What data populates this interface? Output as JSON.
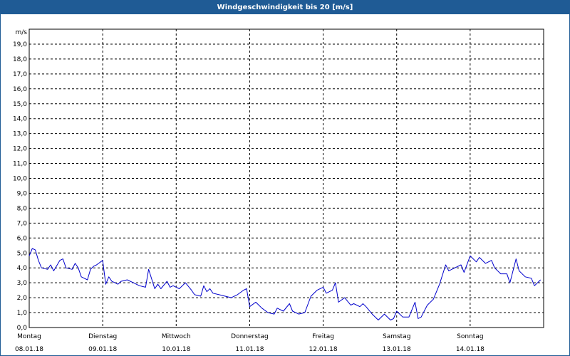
{
  "colors": {
    "title_bg": "#1f5b95",
    "title_text": "#ffffff",
    "line": "#0000cc",
    "grid": "#000000"
  },
  "chart_data": {
    "type": "line",
    "title": "Windgeschwindigkeit bis 20 [m/s]",
    "ylabel": "m/s",
    "xlabel": "",
    "ylim": [
      0,
      20
    ],
    "xlim": [
      "2018-01-08 00:00",
      "2018-01-15 00:00"
    ],
    "y_ticks": [
      "0,0",
      "1,0",
      "2,0",
      "3,0",
      "4,0",
      "5,0",
      "6,0",
      "7,0",
      "8,0",
      "9,0",
      "10,0",
      "11,0",
      "12,0",
      "13,0",
      "14,0",
      "15,0",
      "16,0",
      "17,0",
      "18,0",
      "19,0"
    ],
    "x_ticks": [
      {
        "day": "Montag",
        "date": "08.01.18"
      },
      {
        "day": "Dienstag",
        "date": "09.01.18"
      },
      {
        "day": "Mittwoch",
        "date": "10.01.18"
      },
      {
        "day": "Donnerstag",
        "date": "11.01.18"
      },
      {
        "day": "Freitag",
        "date": "12.01.18"
      },
      {
        "day": "Samstag",
        "date": "13.01.18"
      },
      {
        "day": "Sonntag",
        "date": "14.01.18"
      }
    ],
    "grid": true,
    "legend": "none",
    "series": [
      {
        "x": [
          "2018-01-08 00:00",
          "2018-01-08 01:00",
          "2018-01-08 02:00",
          "2018-01-08 03:00",
          "2018-01-08 04:00",
          "2018-01-08 06:00",
          "2018-01-08 07:00",
          "2018-01-08 08:00",
          "2018-01-08 10:00",
          "2018-01-08 11:00",
          "2018-01-08 12:00",
          "2018-01-08 14:00",
          "2018-01-08 15:00",
          "2018-01-08 16:00",
          "2018-01-08 17:00",
          "2018-01-08 19:00",
          "2018-01-08 20:00",
          "2018-01-08 21:00",
          "2018-01-08 22:00",
          "2018-01-09 00:00",
          "2018-01-09 01:00",
          "2018-01-09 02:00",
          "2018-01-09 03:00",
          "2018-01-09 05:00",
          "2018-01-09 06:00",
          "2018-01-09 08:00",
          "2018-01-09 10:00",
          "2018-01-09 12:00",
          "2018-01-09 14:00",
          "2018-01-09 15:00",
          "2018-01-09 17:00",
          "2018-01-09 18:00",
          "2018-01-09 19:00",
          "2018-01-09 21:00",
          "2018-01-09 22:00",
          "2018-01-09 23:00",
          "2018-01-10 01:00",
          "2018-01-10 03:00",
          "2018-01-10 05:00",
          "2018-01-10 06:00",
          "2018-01-10 08:00",
          "2018-01-10 09:00",
          "2018-01-10 10:00",
          "2018-01-10 11:00",
          "2018-01-10 12:00",
          "2018-01-10 14:00",
          "2018-01-10 16:00",
          "2018-01-10 18:00",
          "2018-01-10 20:00",
          "2018-01-10 22:00",
          "2018-01-10 23:00",
          "2018-01-11 00:00",
          "2018-01-11 02:00",
          "2018-01-11 04:00",
          "2018-01-11 06:00",
          "2018-01-11 08:00",
          "2018-01-11 09:00",
          "2018-01-11 11:00",
          "2018-01-11 13:00",
          "2018-01-11 14:00",
          "2018-01-11 16:00",
          "2018-01-11 18:00",
          "2018-01-11 20:00",
          "2018-01-11 22:00",
          "2018-01-12 00:00",
          "2018-01-12 01:00",
          "2018-01-12 03:00",
          "2018-01-12 04:00",
          "2018-01-12 05:00",
          "2018-01-12 07:00",
          "2018-01-12 09:00",
          "2018-01-12 10:00",
          "2018-01-12 12:00",
          "2018-01-12 13:00",
          "2018-01-12 14:00",
          "2018-01-12 16:00",
          "2018-01-12 18:00",
          "2018-01-12 20:00",
          "2018-01-12 22:00",
          "2018-01-12 23:00",
          "2018-01-13 00:00",
          "2018-01-13 02:00",
          "2018-01-13 04:00",
          "2018-01-13 05:00",
          "2018-01-13 06:00",
          "2018-01-13 07:00",
          "2018-01-13 08:00",
          "2018-01-13 10:00",
          "2018-01-13 12:00",
          "2018-01-13 14:00",
          "2018-01-13 16:00",
          "2018-01-13 17:00",
          "2018-01-13 19:00",
          "2018-01-13 21:00",
          "2018-01-13 22:00",
          "2018-01-14 00:00",
          "2018-01-14 02:00",
          "2018-01-14 03:00",
          "2018-01-14 05:00",
          "2018-01-14 07:00",
          "2018-01-14 08:00",
          "2018-01-14 10:00",
          "2018-01-14 12:00",
          "2018-01-14 13:00",
          "2018-01-14 15:00",
          "2018-01-14 16:00",
          "2018-01-14 18:00",
          "2018-01-14 20:00",
          "2018-01-14 21:00",
          "2018-01-14 23:00"
        ],
        "values": [
          4.8,
          5.3,
          5.2,
          4.5,
          4.0,
          3.9,
          4.2,
          3.8,
          4.5,
          4.6,
          4.0,
          3.9,
          4.3,
          4.0,
          3.4,
          3.2,
          3.9,
          4.1,
          4.2,
          4.5,
          2.9,
          3.4,
          3.1,
          2.9,
          3.1,
          3.2,
          3.0,
          2.8,
          2.7,
          3.9,
          2.6,
          2.9,
          2.6,
          3.1,
          2.7,
          2.8,
          2.6,
          3.0,
          2.5,
          2.2,
          2.1,
          2.8,
          2.4,
          2.6,
          2.3,
          2.2,
          2.1,
          2.0,
          2.2,
          2.5,
          2.6,
          1.4,
          1.7,
          1.3,
          1.0,
          0.9,
          1.3,
          1.1,
          1.6,
          1.1,
          0.9,
          1.0,
          2.1,
          2.5,
          2.7,
          2.3,
          2.5,
          3.0,
          1.7,
          2.0,
          1.5,
          1.6,
          1.4,
          1.6,
          1.4,
          0.9,
          0.5,
          0.9,
          0.5,
          0.6,
          1.1,
          0.7,
          0.7,
          1.2,
          1.7,
          0.6,
          0.7,
          1.5,
          1.9,
          2.9,
          4.2,
          3.8,
          4.0,
          4.2,
          3.7,
          4.8,
          4.4,
          4.7,
          4.3,
          4.5,
          4.0,
          3.6,
          3.6,
          3.0,
          4.6,
          3.8,
          3.4,
          3.3,
          2.8,
          3.2
        ]
      }
    ]
  }
}
